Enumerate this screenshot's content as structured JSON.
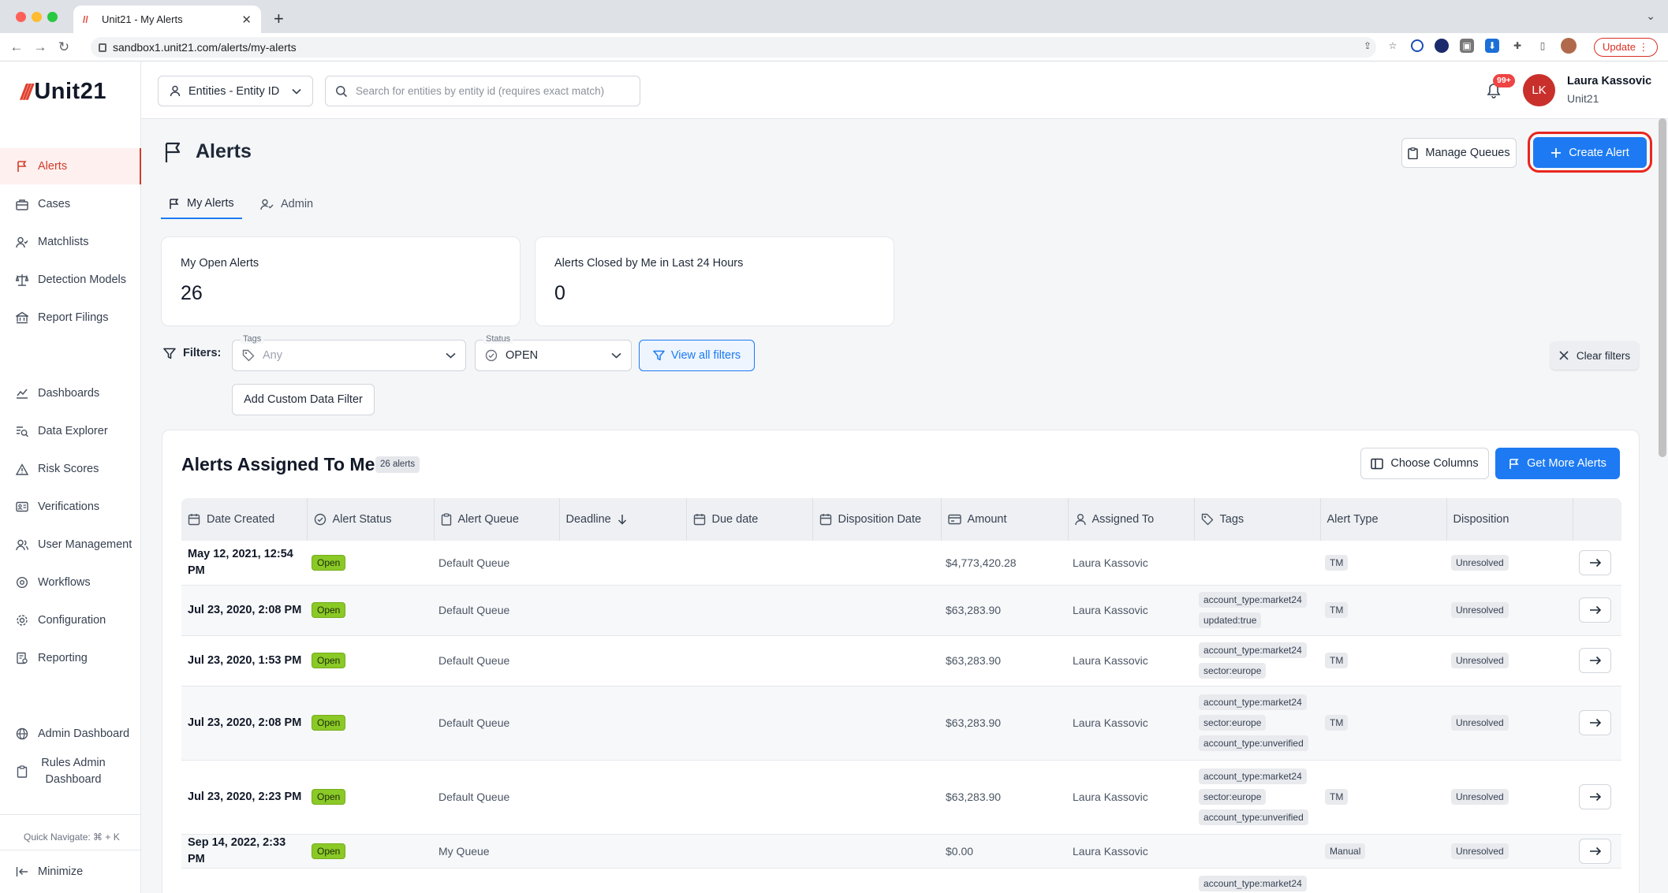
{
  "browser": {
    "tab_title": "Unit21 - My Alerts",
    "url": "sandbox1.unit21.com/alerts/my-alerts",
    "update_label": "Update"
  },
  "sidebar": {
    "logo_text": "Unit21",
    "items": [
      {
        "label": "Alerts",
        "icon": "flag-icon"
      },
      {
        "label": "Cases",
        "icon": "briefcase-icon"
      },
      {
        "label": "Matchlists",
        "icon": "user-check-icon"
      },
      {
        "label": "Detection Models",
        "icon": "scale-icon"
      },
      {
        "label": "Report Filings",
        "icon": "bank-icon"
      },
      {
        "label": "Dashboards",
        "icon": "chart-line-icon"
      },
      {
        "label": "Data Explorer",
        "icon": "search-list-icon"
      },
      {
        "label": "Risk Scores",
        "icon": "warning-icon"
      },
      {
        "label": "Verifications",
        "icon": "id-card-icon"
      },
      {
        "label": "User Management",
        "icon": "users-icon"
      },
      {
        "label": "Workflows",
        "icon": "workflow-icon"
      },
      {
        "label": "Configuration",
        "icon": "gear-icon"
      },
      {
        "label": "Reporting",
        "icon": "report-icon"
      },
      {
        "label": "Admin Dashboard",
        "icon": "globe-icon"
      },
      {
        "label": "Rules Admin Dashboard",
        "icon": "clipboard-icon"
      }
    ],
    "quick_navigate": "Quick Navigate: ⌘ + K",
    "minimize_label": "Minimize"
  },
  "topbar": {
    "entity_select": "Entities - Entity ID",
    "search_placeholder": "Search for entities by entity id (requires exact match)",
    "notification_badge": "99+",
    "user_initials": "LK",
    "user_name": "Laura Kassovic",
    "user_org": "Unit21"
  },
  "page": {
    "title": "Alerts",
    "manage_queues_label": "Manage Queues",
    "create_alert_label": "Create Alert",
    "tabs": [
      {
        "label": "My Alerts",
        "active": true
      },
      {
        "label": "Admin",
        "active": false
      }
    ],
    "cards": [
      {
        "label": "My Open Alerts",
        "value": "26"
      },
      {
        "label": "Alerts Closed by Me in Last 24 Hours",
        "value": "0"
      }
    ],
    "filters": {
      "label": "Filters:",
      "tags_legend": "Tags",
      "tags_value": "Any",
      "status_legend": "Status",
      "status_value": "OPEN",
      "view_all_label": "View all filters",
      "add_custom_label": "Add Custom Data Filter",
      "clear_label": "Clear filters"
    }
  },
  "table": {
    "title": "Alerts Assigned To Me",
    "count_badge": "26 alerts",
    "choose_columns_label": "Choose Columns",
    "get_more_label": "Get More Alerts",
    "columns": [
      "Date Created",
      "Alert Status",
      "Alert Queue",
      "Deadline",
      "Due date",
      "Disposition Date",
      "Amount",
      "Assigned To",
      "Tags",
      "Alert Type",
      "Disposition"
    ],
    "rows": [
      {
        "date": "May 12, 2021, 12:54 PM",
        "status": "Open",
        "queue": "Default Queue",
        "amount": "$4,773,420.28",
        "assigned": "Laura Kassovic",
        "tags": [],
        "type": "TM",
        "disposition": "Unresolved"
      },
      {
        "date": "Jul 23, 2020, 2:08 PM",
        "status": "Open",
        "queue": "Default Queue",
        "amount": "$63,283.90",
        "assigned": "Laura Kassovic",
        "tags": [
          "account_type:market24",
          "updated:true"
        ],
        "type": "TM",
        "disposition": "Unresolved"
      },
      {
        "date": "Jul 23, 2020, 1:53 PM",
        "status": "Open",
        "queue": "Default Queue",
        "amount": "$63,283.90",
        "assigned": "Laura Kassovic",
        "tags": [
          "account_type:market24",
          "sector:europe"
        ],
        "type": "TM",
        "disposition": "Unresolved"
      },
      {
        "date": "Jul 23, 2020, 2:08 PM",
        "status": "Open",
        "queue": "Default Queue",
        "amount": "$63,283.90",
        "assigned": "Laura Kassovic",
        "tags": [
          "account_type:market24",
          "sector:europe",
          "account_type:unverified"
        ],
        "type": "TM",
        "disposition": "Unresolved"
      },
      {
        "date": "Jul 23, 2020, 2:23 PM",
        "status": "Open",
        "queue": "Default Queue",
        "amount": "$63,283.90",
        "assigned": "Laura Kassovic",
        "tags": [
          "account_type:market24",
          "sector:europe",
          "account_type:unverified"
        ],
        "type": "TM",
        "disposition": "Unresolved"
      },
      {
        "date": "Sep 14, 2022, 2:33 PM",
        "status": "Open",
        "queue": "My Queue",
        "amount": "$0.00",
        "assigned": "Laura Kassovic",
        "tags": [],
        "type": "Manual",
        "disposition": "Unresolved"
      },
      {
        "date": "",
        "status": "",
        "queue": "",
        "amount": "",
        "assigned": "",
        "tags": [
          "account_type:market24"
        ],
        "type": "",
        "disposition": ""
      }
    ]
  },
  "colors": {
    "brand_red": "#e0412f",
    "primary_blue": "#1d7af2",
    "status_open_green": "#8ac926"
  }
}
